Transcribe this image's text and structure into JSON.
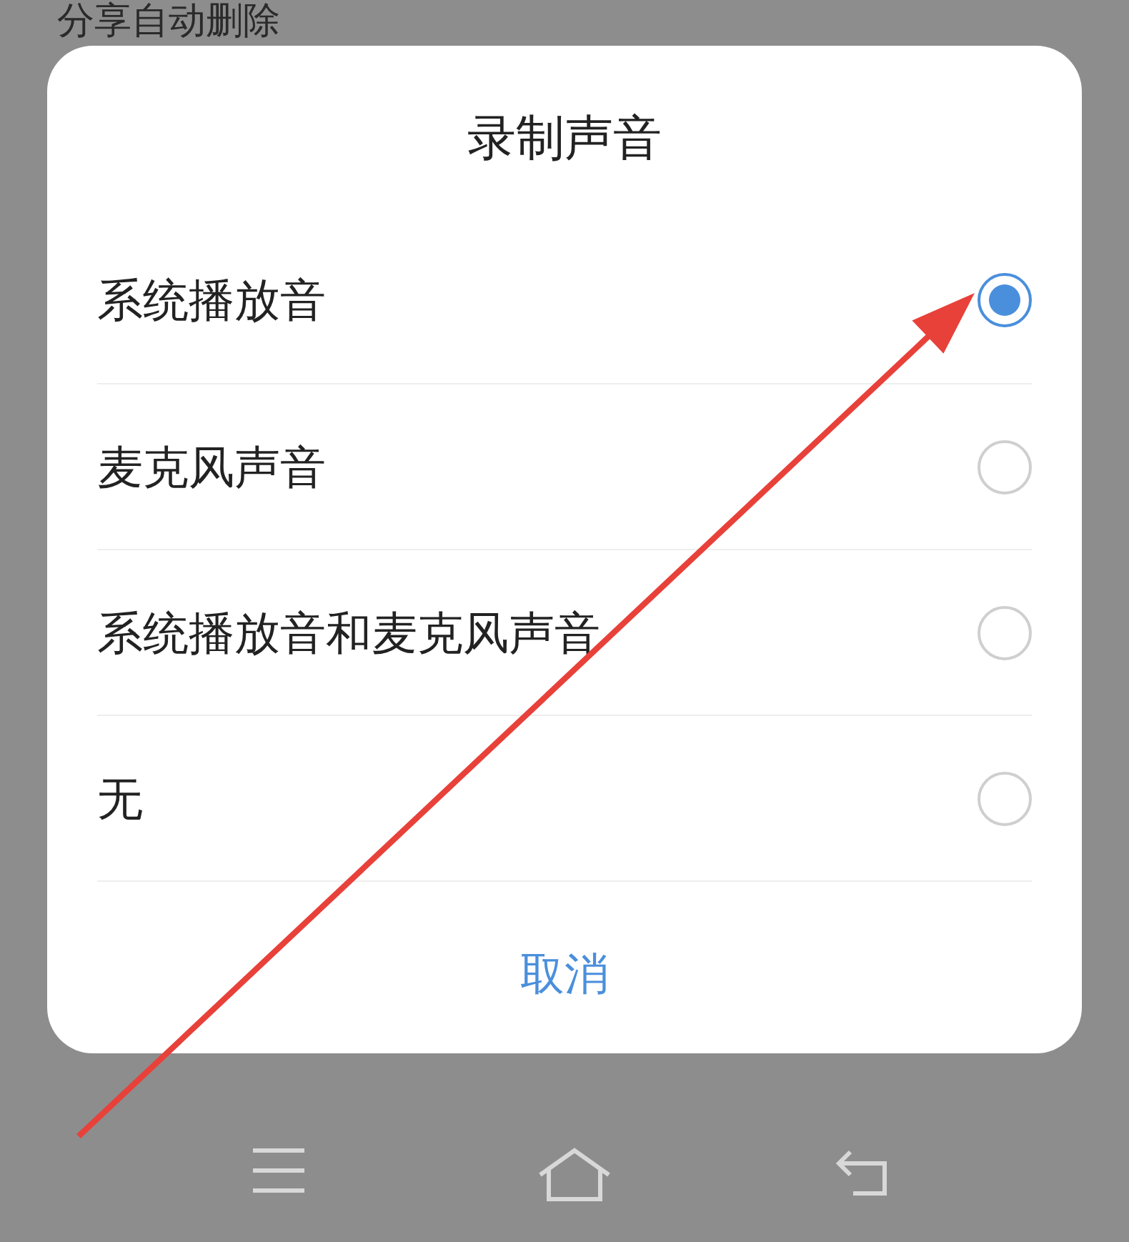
{
  "background_text": "分享自动删除",
  "dialog": {
    "title": "录制声音",
    "options": [
      {
        "label": "系统播放音",
        "selected": true
      },
      {
        "label": "麦克风声音",
        "selected": false
      },
      {
        "label": "系统播放音和麦克风声音",
        "selected": false
      },
      {
        "label": "无",
        "selected": false
      }
    ],
    "cancel": "取消"
  },
  "nav_bar": {
    "buttons": [
      {
        "kind": "menu"
      },
      {
        "kind": "home"
      },
      {
        "kind": "back"
      }
    ]
  },
  "annotations": [
    {
      "kind": "arrow"
    }
  ]
}
